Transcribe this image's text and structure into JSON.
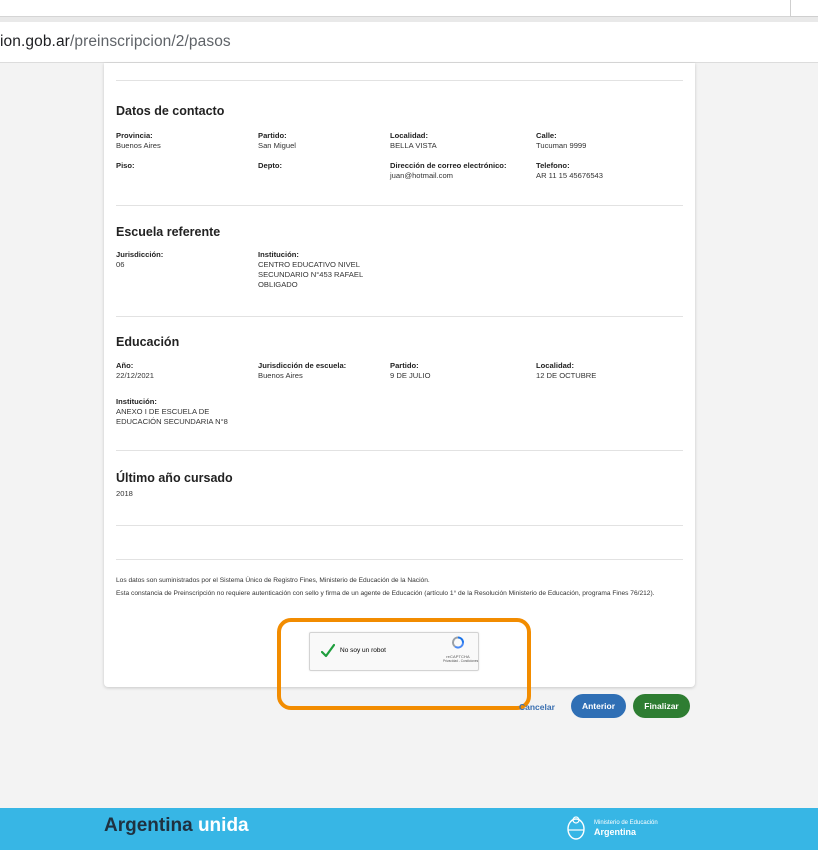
{
  "browser": {
    "url_host": "ion.gob.ar",
    "url_path": "/preinscripcion/2/pasos"
  },
  "contacto": {
    "title": "Datos de contacto",
    "provincia": {
      "label": "Provincia:",
      "value": "Buenos Aires"
    },
    "partido": {
      "label": "Partido:",
      "value": "San Miguel"
    },
    "localidad": {
      "label": "Localidad:",
      "value": "BELLA VISTA"
    },
    "calle": {
      "label": "Calle:",
      "value": "Tucuman 9999"
    },
    "piso": {
      "label": "Piso:",
      "value": ""
    },
    "depto": {
      "label": "Depto:",
      "value": ""
    },
    "correo": {
      "label": "Dirección de correo electrónico:",
      "value": "juan@hotmail.com"
    },
    "telefono": {
      "label": "Telefono:",
      "value": "AR 11 15 45676543"
    }
  },
  "escuela": {
    "title": "Escuela referente",
    "jurisdiccion": {
      "label": "Jurisdicción:",
      "value": "06"
    },
    "institucion": {
      "label": "Institución:",
      "value": "CENTRO EDUCATIVO NIVEL SECUNDARIO N°453 RAFAEL OBLIGADO"
    }
  },
  "educacion": {
    "title": "Educación",
    "anio": {
      "label": "Año:",
      "value": "22/12/2021"
    },
    "jurisdiccion_escuela": {
      "label": "Jurisdicción de escuela:",
      "value": "Buenos Aires"
    },
    "partido": {
      "label": "Partido:",
      "value": "9 DE JULIO"
    },
    "localidad": {
      "label": "Localidad:",
      "value": "12 DE OCTUBRE"
    },
    "institucion": {
      "label": "Institución:",
      "value": "ANEXO I DE ESCUELA DE EDUCACIÓN SECUNDARIA N°8"
    }
  },
  "ultimo": {
    "title": "Último año cursado",
    "value": "2018"
  },
  "notes": {
    "line1": "Los datos son suministrados por el Sistema Único de Registro Fines, Ministerio de Educación de la Nación.",
    "line2": "Esta constancia de Preinscripción no requiere autenticación con sello y firma de un agente de Educación (artículo 1° de la Resolución Ministerio de Educación, programa Fines 76/212)."
  },
  "captcha": {
    "label": "No soy un robot",
    "brand": "reCAPTCHA",
    "links": "Privacidad - Condiciones"
  },
  "actions": {
    "cancel": "Cancelar",
    "prev": "Anterior",
    "finish": "Finalizar"
  },
  "footer": {
    "brand_main": "Argentina ",
    "brand_accent": "unida",
    "ministry_line1": "Ministerio de Educación",
    "ministry_line2": "Argentina"
  },
  "colors": {
    "footer_bg": "#37b6e5",
    "primary_button": "#2f6fb5",
    "finish_button": "#2e7d32",
    "highlight": "#f28c00"
  }
}
